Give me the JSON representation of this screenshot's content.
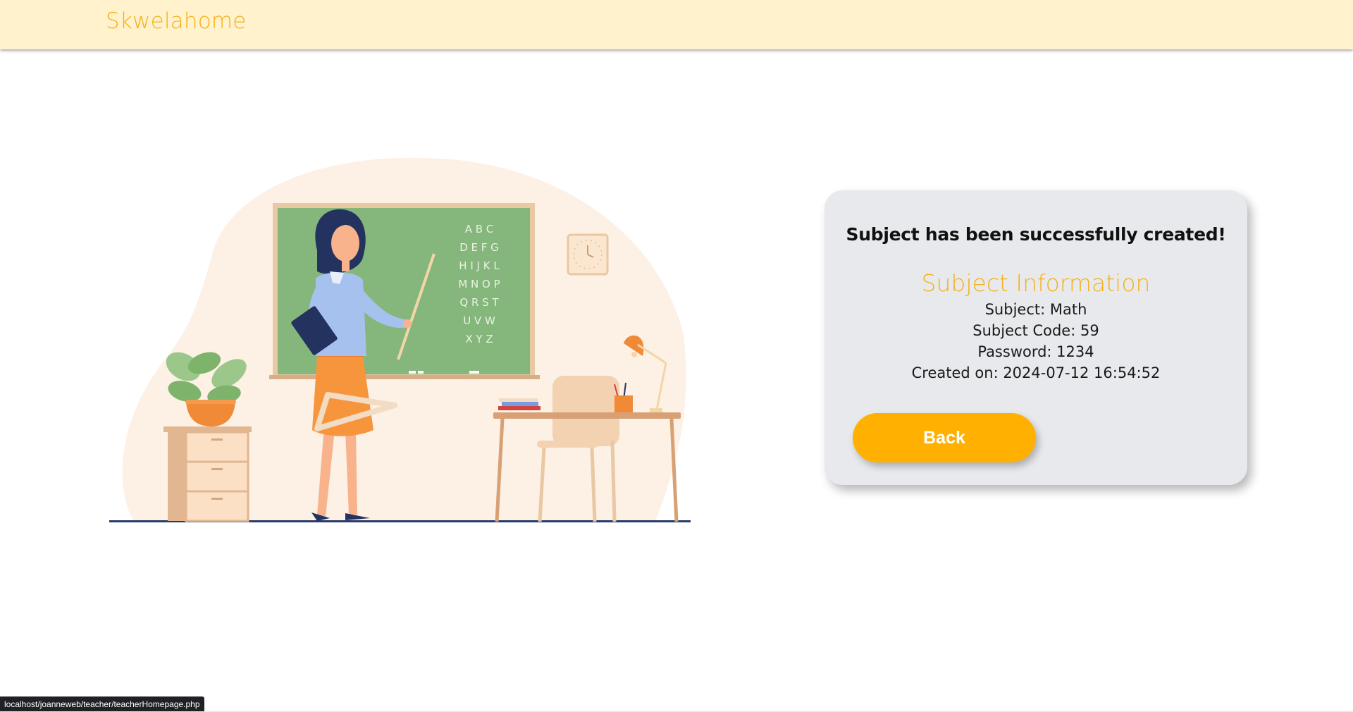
{
  "header": {
    "brand": "Skwelahome"
  },
  "illustration": {
    "description_icon": "teacher-at-chalkboard-illustration",
    "chalkboard_rows": [
      "A B C",
      "D E F G",
      "H I J K L",
      "M N O P",
      "Q R S T",
      "U V W",
      "X Y Z"
    ]
  },
  "card": {
    "title": "Subject has been successfully created!",
    "subtitle": "Subject Information",
    "subject": "Subject: Math",
    "code": "Subject Code: 59",
    "password": "Password: 1234",
    "created": "Created on: 2024-07-12 16:54:52",
    "back_label": "Back"
  },
  "status": {
    "url": "localhost/joanneweb/teacher/teacherHomepage.php"
  },
  "colors": {
    "accent": "#ffb000",
    "header_bg": "#fff2cc",
    "card_bg": "#e8e9ed",
    "chalkboard": "#85b67b"
  }
}
